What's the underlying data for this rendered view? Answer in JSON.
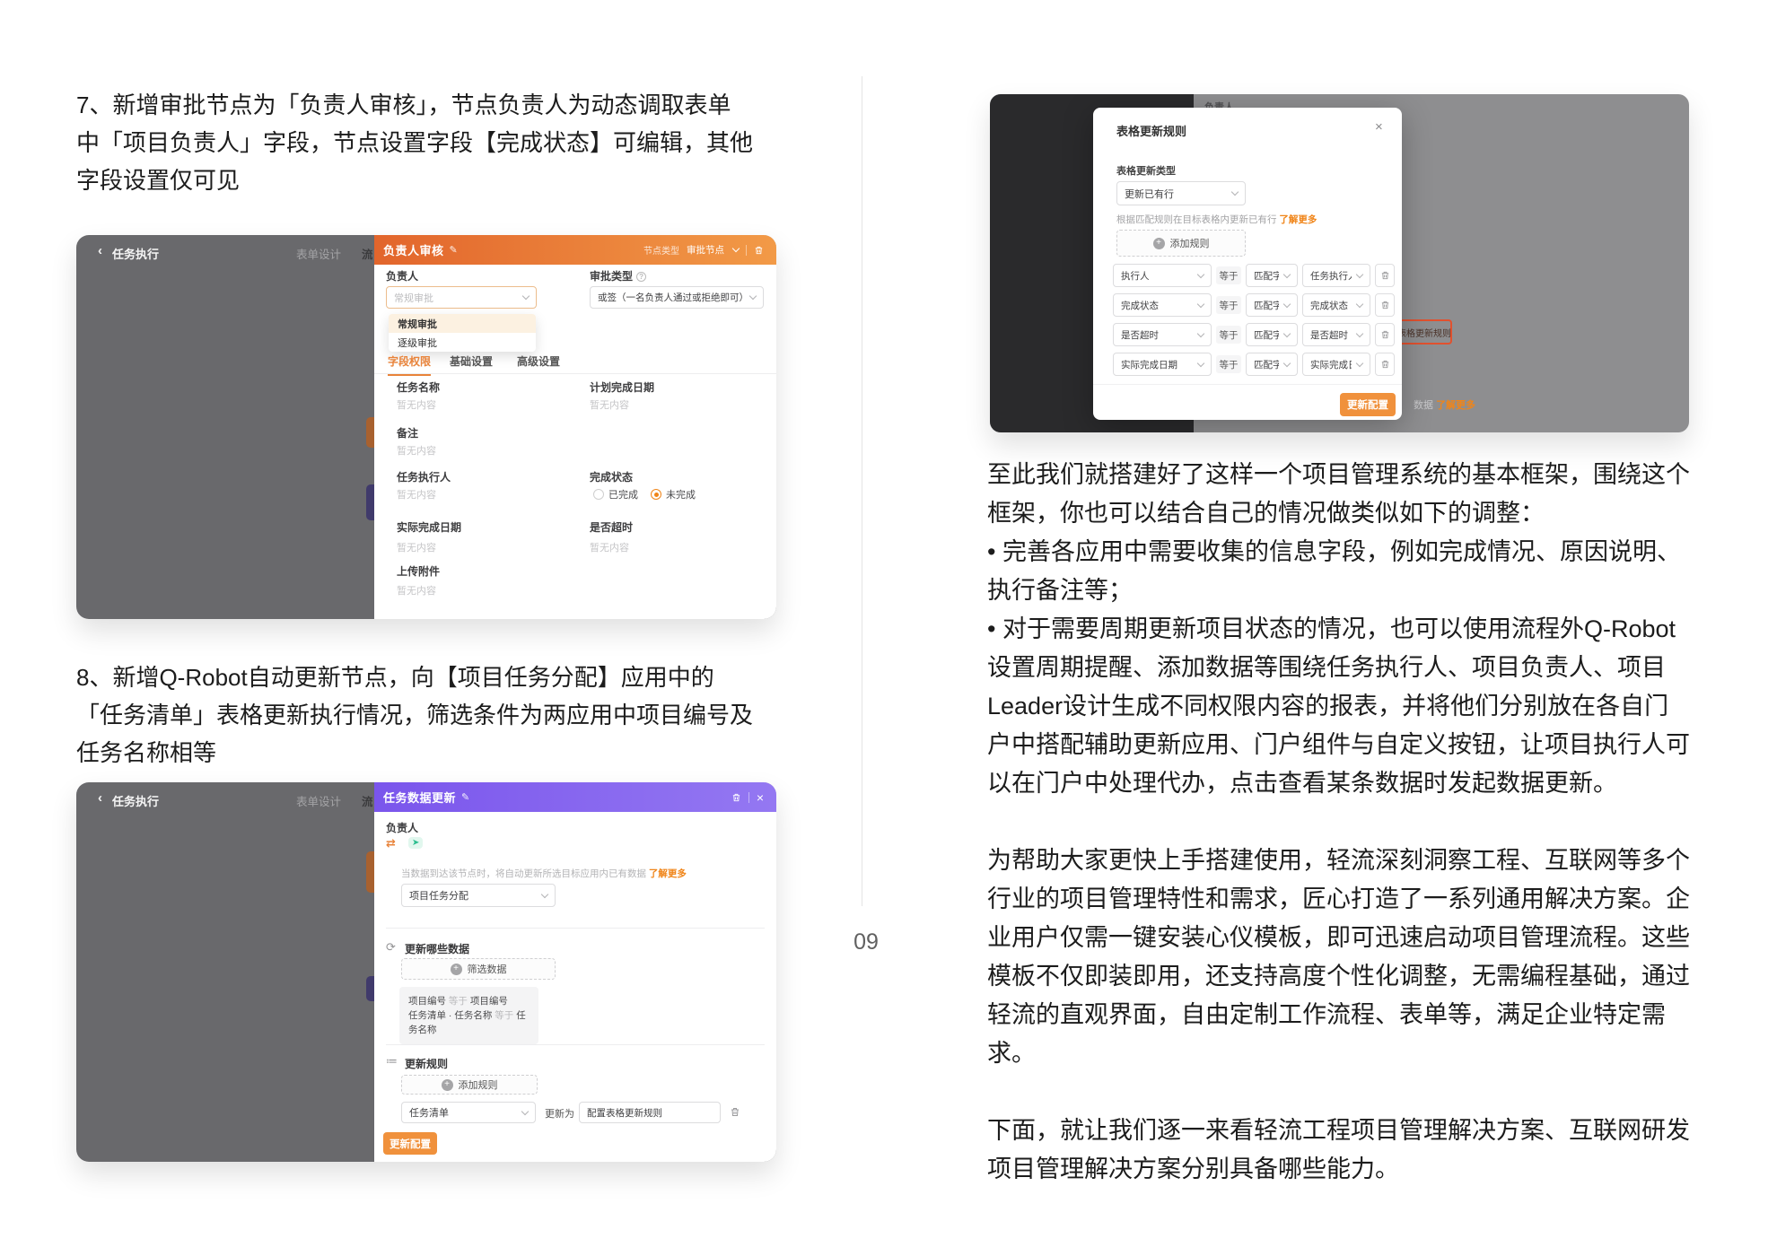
{
  "page": {
    "number": "09"
  },
  "colors": {
    "accent_orange": "#f08519",
    "header_orange_gradient": [
      "#e2652c",
      "#f29a47"
    ],
    "header_purple_gradient": [
      "#7a55ec",
      "#9478f2"
    ],
    "button_orange": "#f0913c",
    "highlight_red": "#e2512e",
    "screenshot_gray": "#69696c",
    "screenshot_dark": "#2a2a2c"
  },
  "left": {
    "para7_lines": [
      "7、新增审批节点为「负责人审核」，节点负责人为动态调取表单",
      "中「项目负责人」字段，节点设置字段【完成状态】可编辑，其他",
      "字段设置仅可见"
    ],
    "para8_lines": [
      "8、新增Q-Robot自动更新节点，向【项目任务分配】应用中的",
      "「任务清单」表格更新执行情况，筛选条件为两应用中项目编号及",
      "任务名称相等"
    ],
    "shot1": {
      "back_icon": "‹",
      "nav_back": "任务执行",
      "nav_tab": "表单设计",
      "nav_tab_clipped": "流程设计",
      "title": "负责人审核",
      "edit_icon": "✎",
      "node_type_label": "节点类型",
      "node_type_value": "审批节点",
      "owner_label": "负责人",
      "owner_input_value": "常规审批",
      "dropdown_items": [
        "常规审批",
        "逐级审批"
      ],
      "approve_type_label": "审批类型",
      "approve_type_value": "或签（一名负责人通过或拒绝即可）",
      "tabs": [
        "字段权限",
        "基础设置",
        "高级设置"
      ],
      "active_tab": "字段权限",
      "empty_text": "暂无内容",
      "field_task_name": "任务名称",
      "field_plan_date": "计划完成日期",
      "field_remark": "备注",
      "field_executor": "任务执行人",
      "field_status": "完成状态",
      "field_actual_date": "实际完成日期",
      "field_overtime": "是否超时",
      "field_upload": "上传附件",
      "radio_done": "已完成",
      "radio_undone": "未完成"
    },
    "shot2": {
      "back_icon": "‹",
      "nav_back": "任务执行",
      "nav_tab": "表单设计",
      "nav_tab_clipped": "流程设计",
      "title": "任务数据更新",
      "edit_icon": "✎",
      "close_icon": "×",
      "owner_label": "负责人",
      "swap_icon": "⇄",
      "plane_icon": "➤",
      "helper_text": "当数据到达该节点时，将自动更新所选目标应用内已有数据",
      "learn_more": "了解更多",
      "app_select_value": "项目任务分配",
      "section_update_data": "更新哪些数据",
      "section_update_data_icon": "⟳",
      "filter_button": "筛选数据",
      "filter_rows": [
        {
          "a": "项目编号",
          "op": "等于",
          "b": "项目编号"
        },
        {
          "a": "任务清单 · 任务名称",
          "op": "等于",
          "b": "任务名称"
        }
      ],
      "section_update_rules": "更新规则",
      "section_update_rules_icon": "≔",
      "add_rule_button": "添加规则",
      "rule_select_value": "任务清单",
      "update_to_label": "更新为",
      "rule_value": "配置表格更新规则",
      "submit_button": "更新配置"
    }
  },
  "right": {
    "shot3": {
      "bg_faint_label": "负责人",
      "bg_highlight": "表格更新规则",
      "bg_partial_text": "数据",
      "bg_partial_link": "了解更多",
      "modal": {
        "title": "表格更新规则",
        "close_icon": "×",
        "type_label": "表格更新类型",
        "type_value": "更新已有行",
        "helper_text": "根据匹配规则在目标表格内更新已有行",
        "learn_more": "了解更多",
        "add_rule_button": "添加规则",
        "equals_label": "等于",
        "match_label": "匹配字段",
        "rules": [
          {
            "source": "执行人",
            "target": "任务执行人"
          },
          {
            "source": "完成状态",
            "target": "完成状态"
          },
          {
            "source": "是否超时",
            "target": "是否超时"
          },
          {
            "source": "实际完成日期",
            "target": "实际完成日期"
          }
        ],
        "submit_button": "更新配置"
      }
    },
    "block1_lines": [
      "至此我们就搭建好了这样一个项目管理系统的基本框架，围绕这个",
      "框架，你也可以结合自己的情况做类似如下的调整：",
      "• 完善各应用中需要收集的信息字段，例如完成情况、原因说明、",
      "执行备注等；",
      "• 对于需要周期更新项目状态的情况，也可以使用流程外Q-Robot",
      "设置周期提醒、添加数据等围绕任务执行人、项目负责人、项目",
      "Leader设计生成不同权限内容的报表，并将他们分别放在各自门",
      "户中搭配辅助更新应用、门户组件与自定义按钮，让项目执行人可",
      "以在门户中处理代办，点击查看某条数据时发起数据更新。"
    ],
    "block2_lines": [
      "为帮助大家更快上手搭建使用，轻流深刻洞察工程、互联网等多个",
      "行业的项目管理特性和需求，匠心打造了一系列通用解决方案。企",
      "业用户仅需一键安装心仪模板，即可迅速启动项目管理流程。这些",
      "模板不仅即装即用，还支持高度个性化调整，无需编程基础，通过",
      "轻流的直观界面，自由定制工作流程、表单等，满足企业特定需",
      "求。"
    ],
    "block3_lines": [
      "下面，就让我们逐一来看轻流工程项目管理解决方案、互联网研发",
      "项目管理解决方案分别具备哪些能力。"
    ]
  }
}
